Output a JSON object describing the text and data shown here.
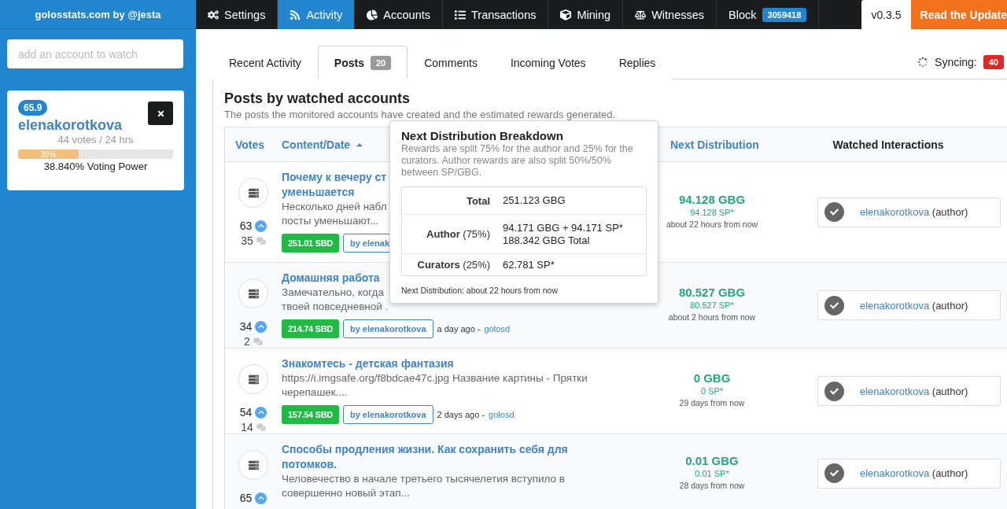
{
  "sidebar": {
    "brand": "golosstats.com by @jesta",
    "search": {
      "placeholder": "add an account to watch"
    },
    "accounts": [
      {
        "reputation": "65.9",
        "name": "elenakorotkova",
        "votes": "44 votes / 24 hrs",
        "level": 0.39,
        "level_label": "39%",
        "voting_power": "38.840% Voting Power"
      }
    ]
  },
  "nav": [
    {
      "label": "Settings",
      "selected": false
    },
    {
      "label": "Activity",
      "selected": true
    },
    {
      "label": "Accounts",
      "selected": false
    },
    {
      "label": "Transactions",
      "selected": false
    },
    {
      "label": "Mining",
      "selected": false
    },
    {
      "label": "Witnesses",
      "selected": false
    },
    {
      "label": "Block",
      "selected": false,
      "badge": "3059418"
    }
  ],
  "version": "v0.3.5",
  "update_link": "Read the Update",
  "tabs": [
    {
      "label": "Recent Activity",
      "selected": false
    },
    {
      "label": "Posts",
      "selected": true,
      "badge": "20"
    },
    {
      "label": "Comments",
      "selected": false
    },
    {
      "label": "Incoming Votes",
      "selected": false
    },
    {
      "label": "Replies",
      "selected": false
    }
  ],
  "sync": {
    "label": "Syncing:",
    "count": "40"
  },
  "panel": {
    "title": "Posts by watched accounts",
    "subtitle": "The posts the monitored accounts have created and the estimated rewards generated."
  },
  "table": {
    "columns": [
      "Votes",
      "Content/Date",
      "Next Distribution",
      "Watched Interactions"
    ],
    "rows": [
      {
        "title_lines": [
          "Почему к вечеру ст",
          "уменьшается"
        ],
        "excerpt_lines": [
          "Несколько дней набл",
          "посты уменьшают..."
        ],
        "votes": "63",
        "comments": "35",
        "payout": "251.01 SBD",
        "author": "by elenak",
        "gbg": "94.128 GBG",
        "sp": "94.128 SP*",
        "when": "about 22 hours from now",
        "interactions": [
          {
            "user": "elenakorotkova",
            "role": "(author)"
          }
        ]
      },
      {
        "title_lines": [
          "Домашняя работа"
        ],
        "excerpt_lines": [
          "Замечательно, когда",
          "твоей повседневной ."
        ],
        "votes": "34",
        "comments": "2",
        "payout": "214.74 SBD",
        "author": "by elenakorotkova",
        "date": "a day ago -",
        "tag": "golosd",
        "gbg": "80.527 GBG",
        "sp": "80.527 SP*",
        "when": "about 2 hours from now",
        "interactions": [
          {
            "user": "elenakorotkova",
            "role": "(author)"
          }
        ]
      },
      {
        "title_lines": [
          "Знакомтесь - детская фантазия"
        ],
        "excerpt_lines": [
          "https://i.imgsafe.org/f8bdcae47c.jpg Название картины - Прятки",
          "черепашек...."
        ],
        "votes": "54",
        "comments": "14",
        "payout": "157.54 SBD",
        "author": "by elenakorotkova",
        "date": "2 days ago -",
        "tag": "golosd",
        "gbg": "0 GBG",
        "sp": "0 SP*",
        "when": "29 days from now",
        "interactions": [
          {
            "user": "elenakorotkova",
            "role": "(author)"
          }
        ]
      },
      {
        "title_lines": [
          "Способы продления жизни. Как сохранить себя для",
          "потомков."
        ],
        "excerpt_lines": [
          "Человечество в начале третьего тысячелетия вступило в",
          "совершенно новый этап..."
        ],
        "votes": "65",
        "gbg": "0.01 GBG",
        "sp": "0.01 SP*",
        "when": "28 days from now",
        "interactions": [
          {
            "user": "elenakorotkova",
            "role": "(author)"
          }
        ]
      }
    ]
  },
  "popover": {
    "title": "Next Distribution Breakdown",
    "text": "Rewards are split 75% for the author and 25% for the curators. Author rewards are also split 50%/50% between SP/GBG.",
    "rows": [
      {
        "label": "**Total**",
        "values": [
          "251.123 GBG"
        ]
      },
      {
        "label": "**Author** (75%)",
        "values": [
          "94.171 GBG + 94.171 SP*",
          "188.342 GBG Total"
        ]
      },
      {
        "label": "**Curators** (25%)",
        "values": [
          "62.781 SP*"
        ]
      }
    ],
    "footer": "Next Distribution: about 22 hours from now"
  }
}
